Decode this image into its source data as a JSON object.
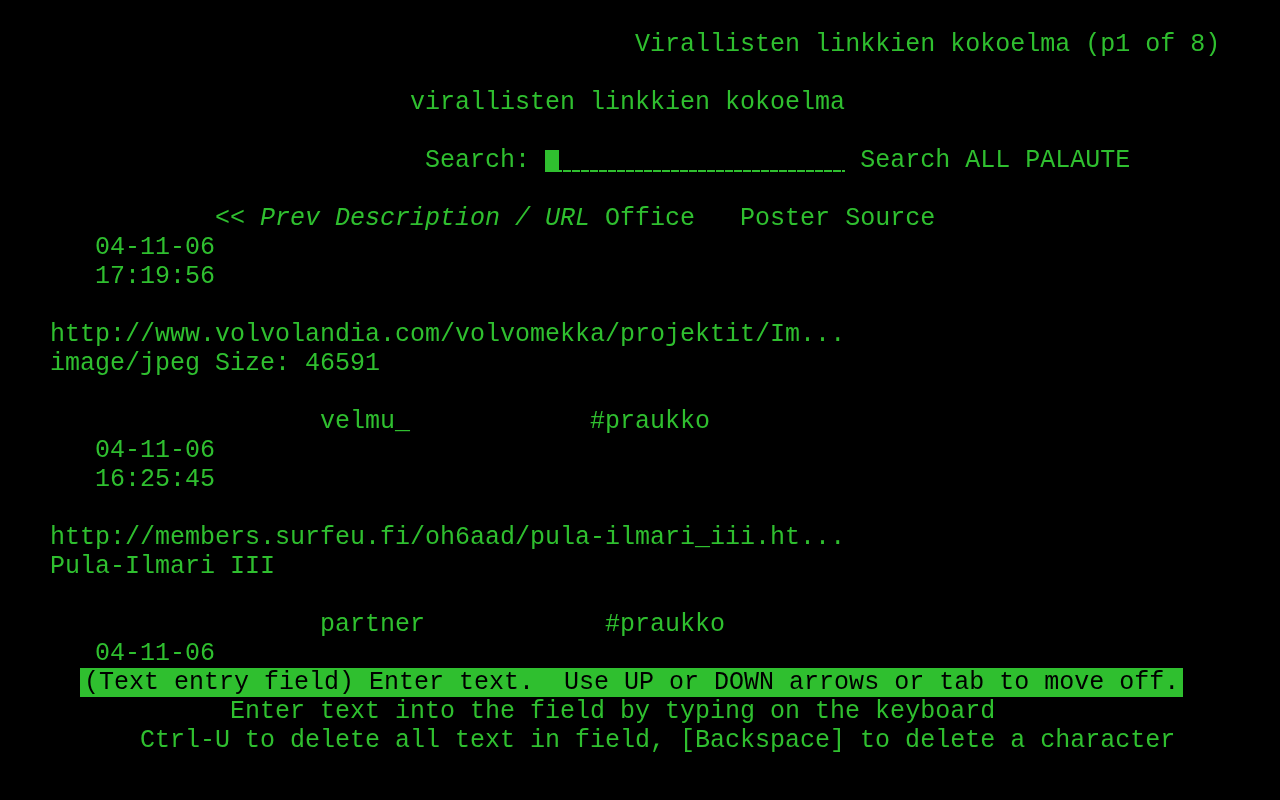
{
  "title_line": "Virallisten linkkien kokoelma (p1 of 8)",
  "heading": "virallisten linkkien kokoelma",
  "search": {
    "label": "Search:",
    "focused": true,
    "links": [
      "Search",
      "ALL",
      "PALAUTE"
    ]
  },
  "columns": [
    "<< Prev",
    "Description / URL",
    "Office",
    "Poster",
    "Source"
  ],
  "entries": [
    {
      "date": "04-11-06",
      "time": "17:19:56",
      "url": "http://www.volvolandia.com/volvomekka/projektit/Im...",
      "description": "image/jpeg Size: 46591",
      "poster": "velmu_",
      "source": "#praukko"
    },
    {
      "date": "04-11-06",
      "time": "16:25:45",
      "url": "http://members.surfeu.fi/oh6aad/pula-ilmari_iii.ht...",
      "description": "Pula-Ilmari III",
      "poster": "partner",
      "source": "#praukko"
    },
    {
      "date": "04-11-06"
    }
  ],
  "status_line": "(Text entry field) Enter text.  Use UP or DOWN arrows or tab to move off.",
  "help_lines": [
    "Enter text into the field by typing on the keyboard",
    "Ctrl-U to delete all text in field, [Backspace] to delete a character"
  ]
}
